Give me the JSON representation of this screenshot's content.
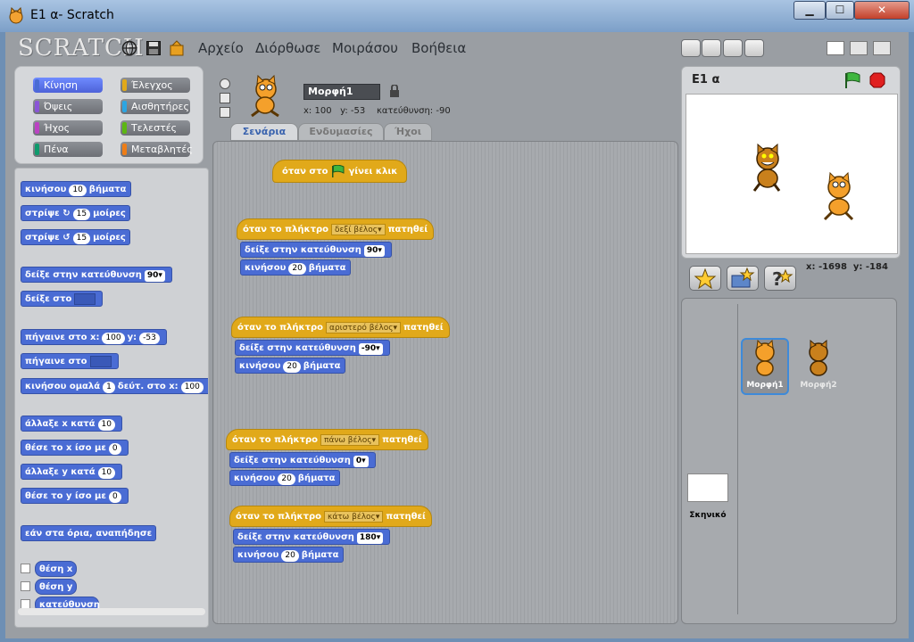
{
  "window": {
    "title": "E1 α- Scratch"
  },
  "menubar": {
    "logo": "SCRATCH",
    "items": [
      "Αρχείο",
      "Διόρθωσε",
      "Μοιράσου",
      "Βοήθεια"
    ]
  },
  "categories": [
    {
      "label": "Κίνηση",
      "color": "#4a6cd4",
      "selected": true
    },
    {
      "label": "Έλεγχος",
      "color": "#e1a91a"
    },
    {
      "label": "Όψεις",
      "color": "#8a55d7"
    },
    {
      "label": "Αισθητήρες",
      "color": "#2ca5e2"
    },
    {
      "label": "Ήχος",
      "color": "#bb42c3"
    },
    {
      "label": "Τελεστές",
      "color": "#5cb712"
    },
    {
      "label": "Πένα",
      "color": "#0e9a6c"
    },
    {
      "label": "Μεταβλητές",
      "color": "#ee7d16"
    }
  ],
  "palette": {
    "move": {
      "text": "κινήσου",
      "value": "10",
      "suffix": "βήματα"
    },
    "turn_right": {
      "text": "στρίψε",
      "value": "15",
      "suffix": "μοίρες"
    },
    "turn_left": {
      "text": "στρίψε",
      "value": "15",
      "suffix": "μοίρες"
    },
    "point_dir": {
      "text": "δείξε στην κατεύθυνση",
      "value": "90"
    },
    "point_to": {
      "text": "δείξε στο"
    },
    "goto_xy": {
      "text": "πήγαινε στο x:",
      "x": "100",
      "ylabel": "y:",
      "y": "-53"
    },
    "goto": {
      "text": "πήγαινε στο"
    },
    "glide": {
      "text": "κινήσου ομαλά",
      "secs": "1",
      "mid": "δεύτ. στο x:",
      "x": "100"
    },
    "change_x": {
      "text": "άλλαξε x κατά",
      "value": "10"
    },
    "set_x": {
      "text": "θέσε το x ίσο με",
      "value": "0"
    },
    "change_y": {
      "text": "άλλαξε y κατά",
      "value": "10"
    },
    "set_y": {
      "text": "θέσε το y ίσο με",
      "value": "0"
    },
    "bounce": {
      "text": "εάν στα όρια, αναπήδησε"
    },
    "rep_x": "θέση x",
    "rep_y": "θέση y",
    "rep_dir": "κατεύθυνση"
  },
  "sprite": {
    "name": "Μορφή1",
    "x_label": "x:",
    "x": "100",
    "y_label": "y:",
    "y": "-53",
    "dir_label": "κατεύθυνση:",
    "dir": "-90"
  },
  "tabs": [
    "Σενάρια",
    "Ενδυμασίες",
    "Ήχοι"
  ],
  "scripts": {
    "flag_hat": {
      "pre": "όταν στο",
      "post": "γίνει κλικ"
    },
    "key_prefix": "όταν το πλήκτρο",
    "key_suffix": "πατηθεί",
    "point_text": "δείξε στην κατεύθυνση",
    "move_text": "κινήσου",
    "move_suffix": "βήματα",
    "s1": {
      "key": "δεξί βέλος",
      "dir": "90",
      "steps": "20"
    },
    "s2": {
      "key": "αριστερό βέλος",
      "dir": "-90",
      "steps": "20"
    },
    "s3": {
      "key": "πάνω βέλος",
      "dir": "0",
      "steps": "20"
    },
    "s4": {
      "key": "κάτω βέλος",
      "dir": "180",
      "steps": "20"
    }
  },
  "stage": {
    "title": "E1 α",
    "mouse_x_label": "x:",
    "mouse_x": "-1698",
    "mouse_y_label": "y:",
    "mouse_y": "-184"
  },
  "sprites_list": {
    "items": [
      "Μορφή1",
      "Μορφή2"
    ],
    "stage_label": "Σκηνικό"
  }
}
